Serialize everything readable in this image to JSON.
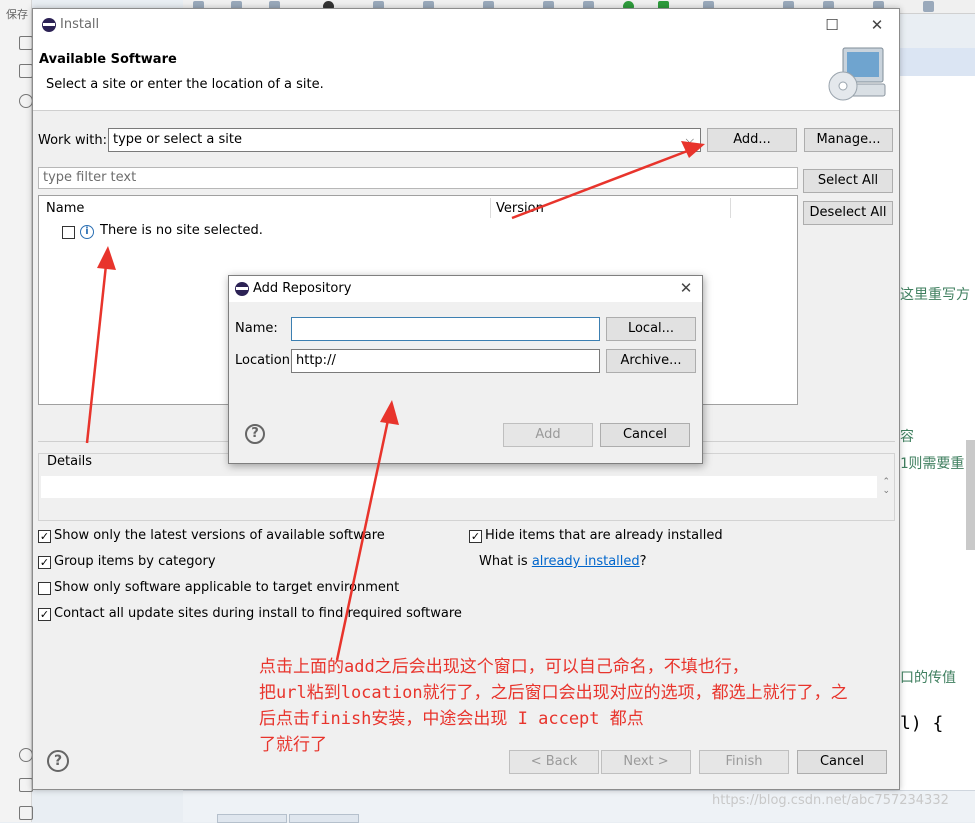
{
  "ide": {
    "save_label": "保存",
    "code_lines": [
      "这里重写方",
      "容",
      "1则需要重",
      "口的传值",
      "l) {"
    ],
    "watermark": "https://blog.csdn.net/abc757234332"
  },
  "install": {
    "window_title": "Install",
    "banner_title": "Available Software",
    "banner_subtitle": "Select a site or enter the location of a site.",
    "work_with_label": "Work with:",
    "work_with_value": "type or select a site",
    "add_button": "Add...",
    "manage_button": "Manage...",
    "filter_placeholder": "type filter text",
    "select_all_button": "Select All",
    "deselect_all_button": "Deselect All",
    "columns": [
      "Name",
      "Version"
    ],
    "empty_row": "There is no site selected.",
    "details_label": "Details",
    "options_left": [
      {
        "label": "Show only the latest versions of available software",
        "checked": true
      },
      {
        "label": "Group items by category",
        "checked": true
      },
      {
        "label": "Show only software applicable to target environment",
        "checked": false
      },
      {
        "label": "Contact all update sites during install to find required software",
        "checked": true
      }
    ],
    "options_right": {
      "label": "Hide items that are already installed",
      "checked": true
    },
    "what_is_prefix": "What is ",
    "what_is_link": "already installed",
    "what_is_suffix": "?",
    "back_button": "< Back",
    "next_button": "Next >",
    "finish_button": "Finish",
    "cancel_button": "Cancel"
  },
  "repo_dialog": {
    "title": "Add Repository",
    "name_label": "Name:",
    "name_value": "",
    "location_label": "Location:",
    "location_value": "http://",
    "local_button": "Local...",
    "archive_button": "Archive...",
    "add_button": "Add",
    "cancel_button": "Cancel"
  },
  "annotation": {
    "lines": [
      "点击上面的add之后会出现这个窗口，可以自己命名，不填也行，",
      "把url粘到location就行了，之后窗口会出现对应的选项，都选上就行了，之",
      "后点击finish安装，中途会出现 I accept 都点",
      "了就行了"
    ],
    "color": "#e8342c"
  }
}
